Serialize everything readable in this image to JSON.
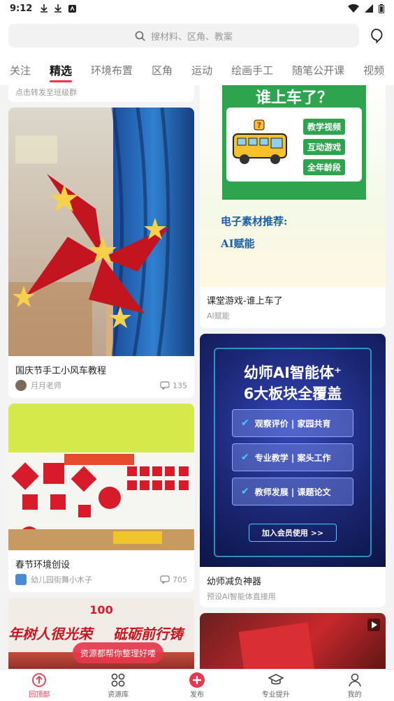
{
  "status": {
    "time": "9:12"
  },
  "search": {
    "placeholder": "搜材料、区角、教案"
  },
  "tabs": [
    {
      "label": "关注"
    },
    {
      "label": "精选"
    },
    {
      "label": "环境布置"
    },
    {
      "label": "区角"
    },
    {
      "label": "运动"
    },
    {
      "label": "绘画手工"
    },
    {
      "label": "随笔公开课"
    },
    {
      "label": "视频"
    }
  ],
  "feed": {
    "top_snippet": "点击转发至班级群",
    "left": [
      {
        "title": "国庆节手工小风车教程",
        "author": "月月老师",
        "comments": "135"
      },
      {
        "title": "春节环境创设",
        "author": "幼儿园街舞小木子",
        "comments": "705"
      },
      {
        "banner_a": "年树人很光荣",
        "banner_b": "砥砺前行铸",
        "badge": "100"
      }
    ],
    "right": [
      {
        "title": "课堂游戏-谁上车了",
        "sub": "AI赋能",
        "poster": {
          "headline": "谁上车了？",
          "tags": [
            "教学视频",
            "互动游戏",
            "全年龄段"
          ],
          "line1": "电子素材推荐:",
          "line2": "AI赋能"
        }
      },
      {
        "title": "幼师减负神器",
        "sub": "预设AI智能体直接用",
        "poster": {
          "headline1": "幼师AI智能体⁺",
          "headline2": "6大板块全覆盖",
          "items": [
            "观察评价 | 家园共育",
            "专业教学 | 案头工作",
            "教师发展 | 课题论文"
          ],
          "cta": "加入会员使用 >>"
        }
      }
    ]
  },
  "toast": "资源都帮你整理好喽",
  "nav": [
    {
      "label": "回顶部"
    },
    {
      "label": "资源库"
    },
    {
      "label": "发布"
    },
    {
      "label": "专业提升"
    },
    {
      "label": "我的"
    }
  ],
  "colors": {
    "accent": "#e8374c",
    "green": "#1f9a3b",
    "poster_blue": "#1a2a7a"
  }
}
